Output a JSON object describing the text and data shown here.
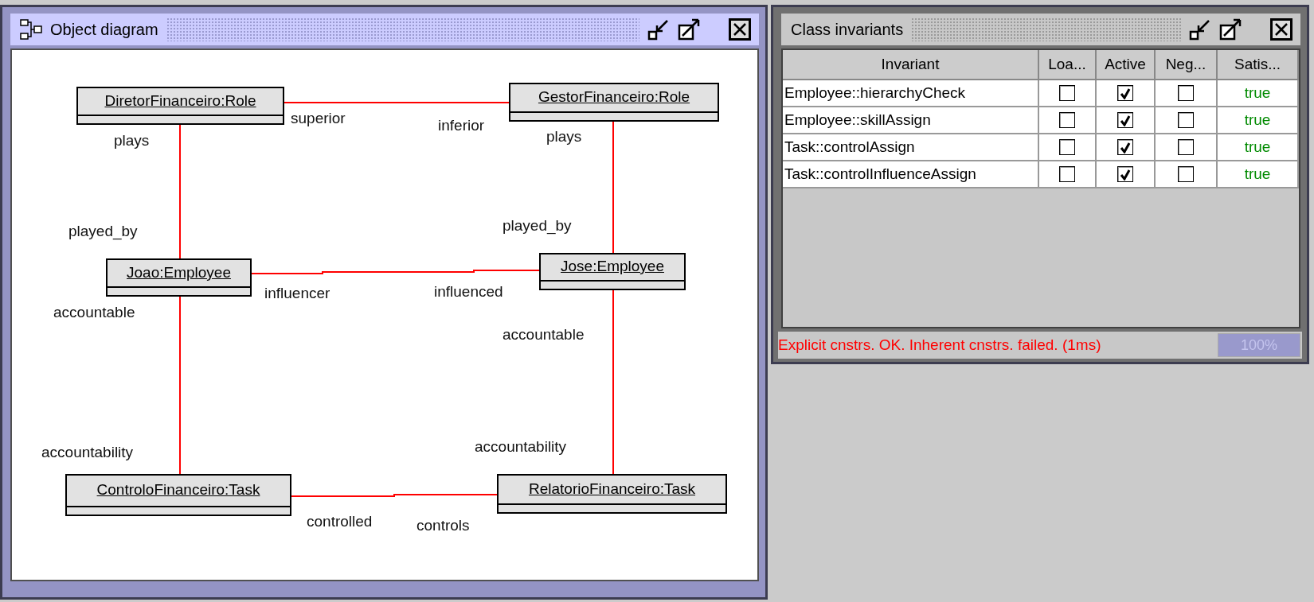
{
  "windows": [
    {
      "kind": "diagram",
      "title": "Object diagram",
      "active": true,
      "objects": [
        {
          "name": "DiretorFinanceiro:Role"
        },
        {
          "name": "GestorFinanceiro:Role"
        },
        {
          "name": "Joao:Employee"
        },
        {
          "name": "Jose:Employee"
        },
        {
          "name": "ControloFinanceiro:Task"
        },
        {
          "name": "RelatorioFinanceiro:Task"
        }
      ],
      "links": [
        {
          "from_role": "superior",
          "to_role": "inferior"
        },
        {
          "from_role": "plays",
          "to_role": "played_by"
        },
        {
          "from_role": "plays",
          "to_role": "played_by"
        },
        {
          "from_role": "influencer",
          "to_role": "influenced"
        },
        {
          "from_role": "accountable",
          "to_role": "accountability"
        },
        {
          "from_role": "accountable",
          "to_role": "accountability"
        },
        {
          "from_role": "controlled",
          "to_role": "controls"
        }
      ]
    },
    {
      "kind": "invariants",
      "title": "Class invariants",
      "active": false,
      "columns": [
        "Invariant",
        "Loa...",
        "Active",
        "Neg...",
        "Satis..."
      ],
      "rows": [
        {
          "invariant": "Employee::hierarchyCheck",
          "loaded": false,
          "active": true,
          "negated": false,
          "satisfied": "true"
        },
        {
          "invariant": "Employee::skillAssign",
          "loaded": false,
          "active": true,
          "negated": false,
          "satisfied": "true"
        },
        {
          "invariant": "Task::controlAssign",
          "loaded": false,
          "active": true,
          "negated": false,
          "satisfied": "true"
        },
        {
          "invariant": "Task::controlInfluenceAssign",
          "loaded": false,
          "active": true,
          "negated": false,
          "satisfied": "true"
        }
      ],
      "status": "Explicit cnstrs. OK. Inherent cnstrs. failed. (1ms)",
      "progress": {
        "label": "100%",
        "level": 1
      }
    }
  ]
}
